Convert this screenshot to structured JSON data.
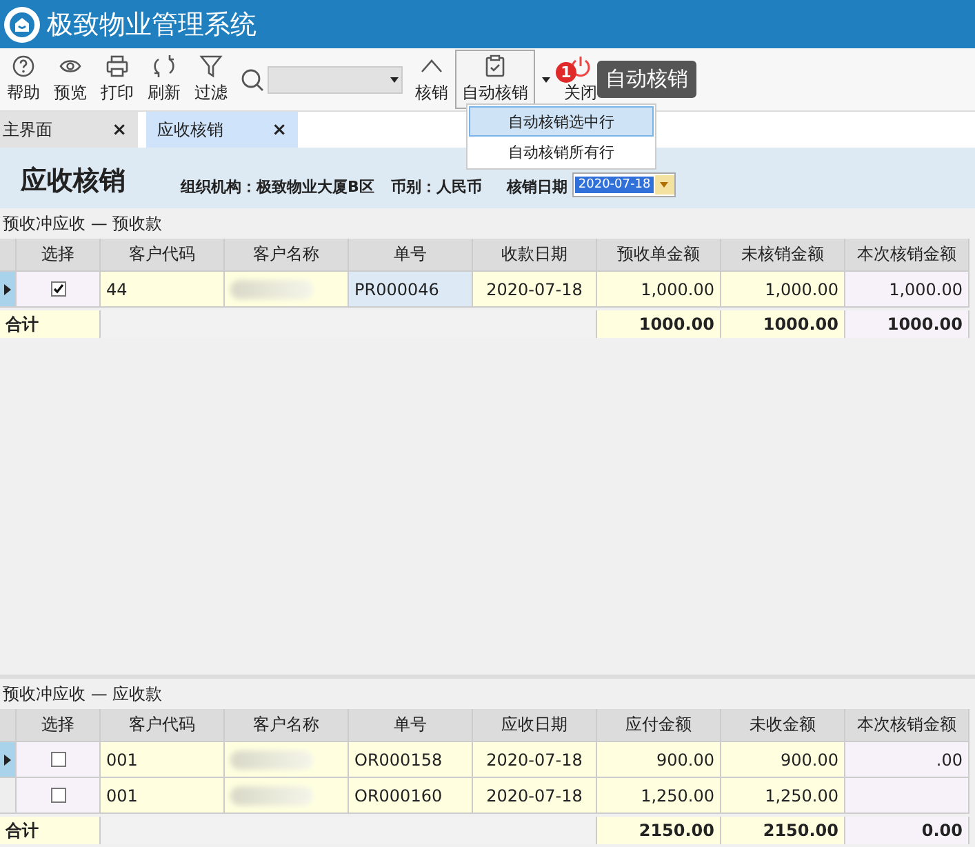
{
  "window": {
    "title": "极致物业管理系统"
  },
  "toolbar": {
    "items": [
      {
        "kind": "help",
        "label": "帮助"
      },
      {
        "kind": "preview",
        "label": "预览"
      },
      {
        "kind": "print",
        "label": "打印"
      },
      {
        "kind": "refresh",
        "label": "刷新"
      },
      {
        "kind": "filter",
        "label": "过滤"
      },
      {
        "kind": "search"
      },
      {
        "kind": "up",
        "label": "核销"
      },
      {
        "kind": "auto",
        "label": "自动核销",
        "open": true
      },
      {
        "kind": "power",
        "label": "关闭"
      }
    ],
    "badge": "1",
    "tooltip": "自动核销",
    "menu": [
      {
        "label": "自动核销选中行",
        "selected": true
      },
      {
        "label": "自动核销所有行",
        "selected": false
      }
    ]
  },
  "tabs": [
    {
      "label": "主界面",
      "selected": false,
      "close": "×"
    },
    {
      "label": "应收核销",
      "selected": true,
      "close": "×"
    }
  ],
  "header": {
    "title": "应收核销",
    "org": "组织机构：极致物业大厦B区",
    "currency": "币别：人民币",
    "date_label": "核销日期",
    "date_value": "2020-07-18"
  },
  "grids": [
    {
      "caption": "预收冲应收 — 预收款",
      "columns": [
        "选择",
        "客户代码",
        "客户名称",
        "单号",
        "收款日期",
        "预收单金额",
        "未核销金额",
        "本次核销金额"
      ],
      "rows": [
        {
          "current": true,
          "checked": true,
          "focused": true,
          "code": "44",
          "number": "PR000046",
          "date": "2020-07-18",
          "amounts": [
            "1,000.00",
            "1,000.00",
            "1,000.00"
          ]
        }
      ],
      "total_label": "合计",
      "totals": [
        "1000.00",
        "1000.00",
        "1000.00"
      ]
    },
    {
      "caption": "预收冲应收 — 应收款",
      "columns": [
        "选择",
        "客户代码",
        "客户名称",
        "单号",
        "应收日期",
        "应付金额",
        "未收金额",
        "本次核销金额"
      ],
      "rows": [
        {
          "current": true,
          "checked": false,
          "focused": false,
          "code": "001",
          "number": "OR000158",
          "date": "2020-07-18",
          "amounts": [
            "900.00",
            "900.00",
            ".00"
          ]
        },
        {
          "current": false,
          "checked": false,
          "focused": false,
          "code": "001",
          "number": "OR000160",
          "date": "2020-07-18",
          "amounts": [
            "1,250.00",
            "1,250.00"
          ]
        }
      ],
      "total_label": "合计",
      "totals": [
        "2150.00",
        "2150.00",
        "0.00"
      ]
    }
  ]
}
